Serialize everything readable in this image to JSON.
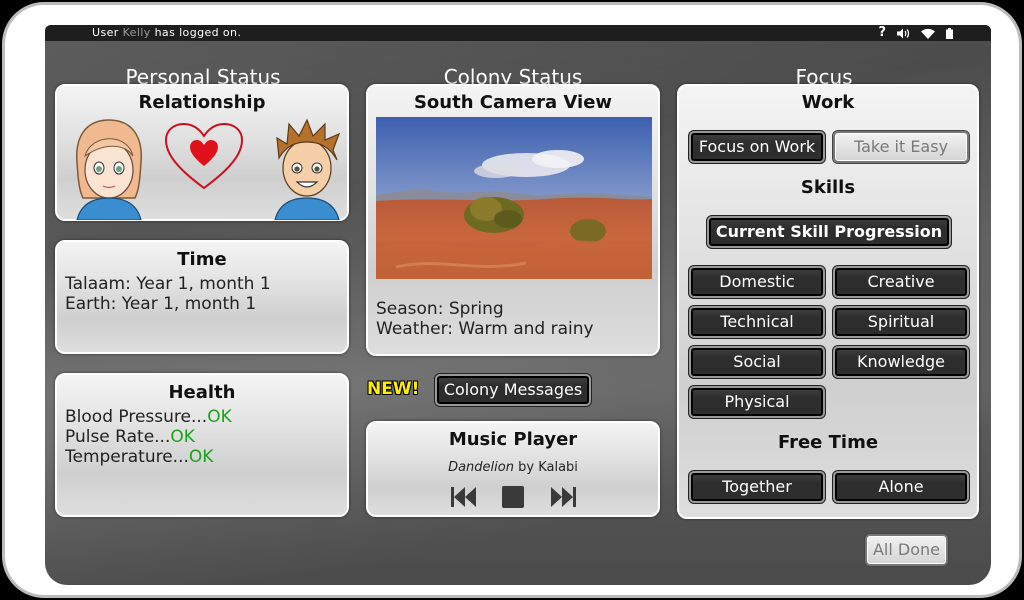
{
  "status_bar": {
    "login_prefix": "User",
    "user_name": "Kelly",
    "login_suffix": "has logged on.",
    "help_label": "?"
  },
  "columns": {
    "personal": "Personal Status",
    "colony": "Colony Status",
    "focus": "Focus"
  },
  "relationship": {
    "title": "Relationship"
  },
  "time": {
    "title": "Time",
    "talaam": "Talaam: Year 1, month 1",
    "earth": "Earth: Year 1, month 1"
  },
  "health": {
    "title": "Health",
    "rows": [
      {
        "label": "Blood Pressure...",
        "value": "OK"
      },
      {
        "label": "Pulse Rate...",
        "value": "OK"
      },
      {
        "label": "Temperature...",
        "value": "OK"
      }
    ]
  },
  "camera": {
    "title": "South Camera View",
    "season": "Season: Spring",
    "weather": "Weather: Warm and rainy"
  },
  "messages": {
    "new_label": "NEW!",
    "button_label": "Colony Messages"
  },
  "music": {
    "title": "Music Player",
    "song": "Dandelion",
    "by": "by",
    "artist": "Kalabi"
  },
  "focus": {
    "work_title": "Work",
    "focus_on_work": "Focus on Work",
    "take_it_easy": "Take it Easy",
    "skills_title": "Skills",
    "skill_progression": "Current Skill Progression",
    "skills": {
      "domestic": "Domestic",
      "creative": "Creative",
      "technical": "Technical",
      "spiritual": "Spiritual",
      "social": "Social",
      "knowledge": "Knowledge",
      "physical": "Physical"
    },
    "free_time_title": "Free Time",
    "together": "Together",
    "alone": "Alone"
  },
  "all_done": "All Done",
  "colors": {
    "ok": "#1aa21a",
    "new_label": "#ffee00",
    "heart": "#e0101a",
    "button_dark": "#2d2d2d"
  }
}
